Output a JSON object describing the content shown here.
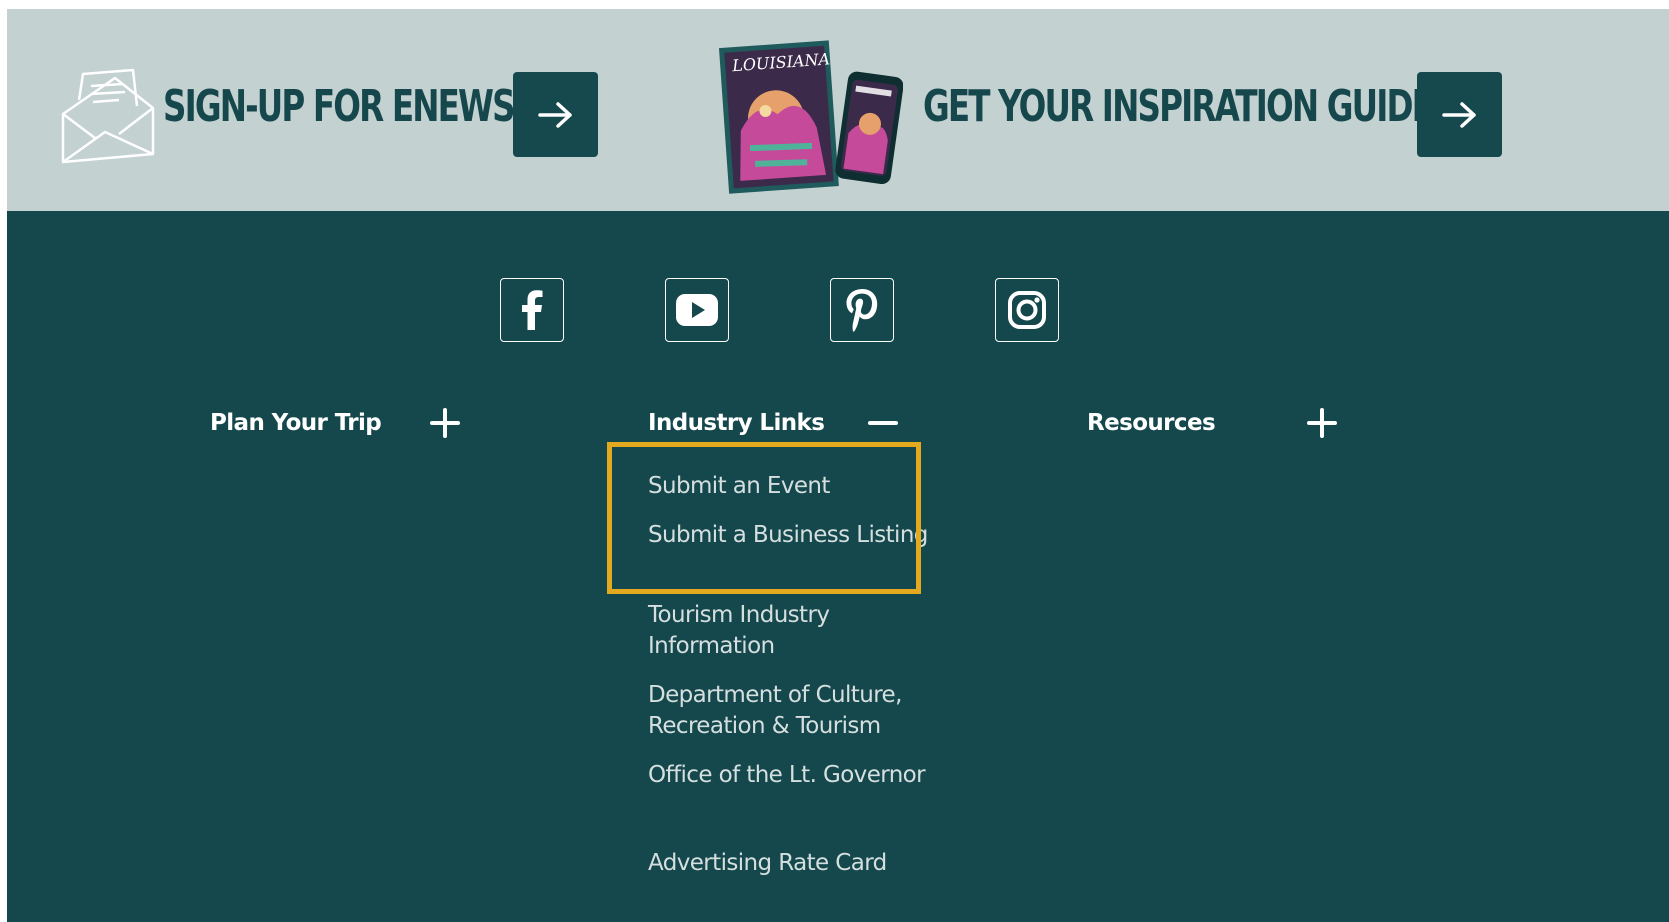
{
  "promo": {
    "enews_title": "SIGN-UP FOR ENEWS",
    "guide_title": "GET YOUR INSPIRATION GUIDE",
    "guide_cover_text": "LOUISIANA",
    "enews_icon": "envelope-icon",
    "arrow_icon": "arrow-right-icon"
  },
  "social": [
    {
      "name": "facebook-icon"
    },
    {
      "name": "youtube-icon"
    },
    {
      "name": "pinterest-icon"
    },
    {
      "name": "instagram-icon"
    }
  ],
  "footer": {
    "columns": [
      {
        "heading": "Plan Your Trip",
        "toggle": "+",
        "expanded": false
      },
      {
        "heading": "Industry Links",
        "toggle": "−",
        "expanded": true
      },
      {
        "heading": "Resources",
        "toggle": "+",
        "expanded": false
      }
    ],
    "industry_links": [
      "Submit an Event",
      "Submit a Business Listing",
      "Tourism Industry Information",
      "Department of Culture, Recreation & Tourism",
      "Office of the Lt. Governor",
      "Advertising Rate Card"
    ]
  },
  "colors": {
    "promo_bg": "#c3d1d0",
    "footer_bg": "#15484c",
    "accent_dark": "#16494e",
    "highlight": "#e3aa1f",
    "link_text": "#d6dfdf"
  }
}
